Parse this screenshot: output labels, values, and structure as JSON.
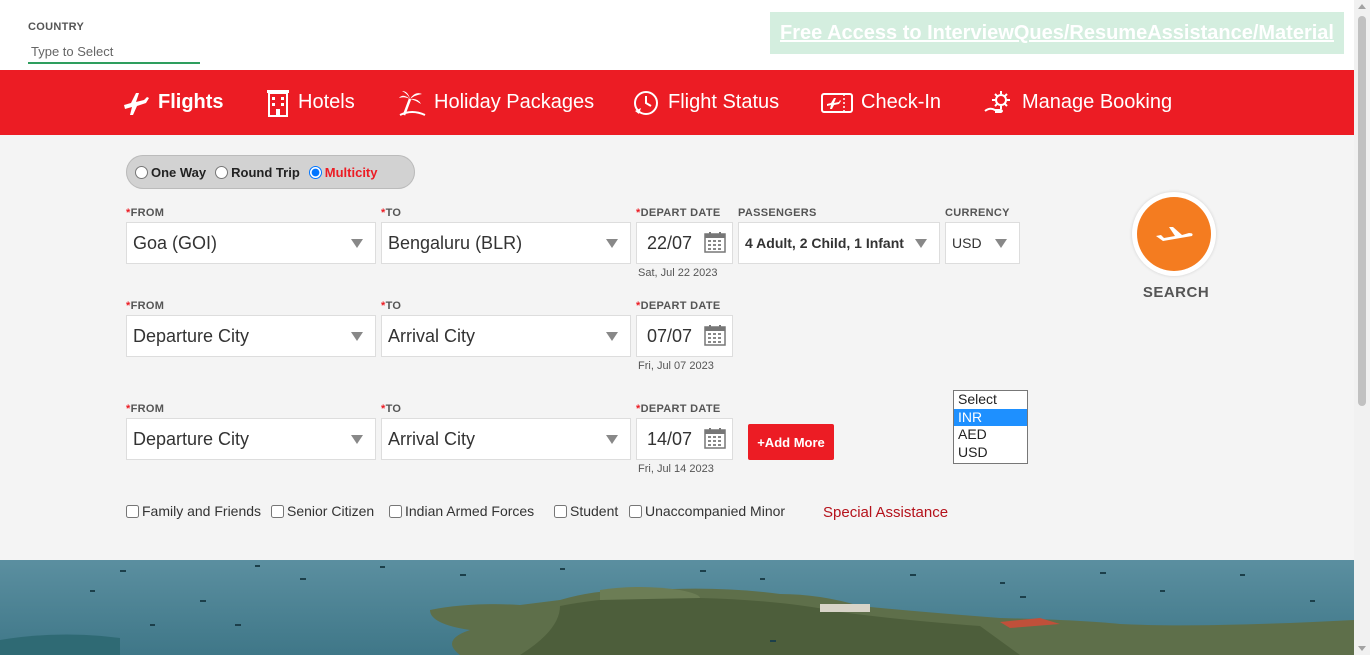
{
  "country": {
    "label": "COUNTRY",
    "placeholder": "Type to Select"
  },
  "promo": {
    "text": "Free Access to InterviewQues/ResumeAssistance/Material"
  },
  "nav": {
    "items": [
      {
        "label": "Flights",
        "icon": "plane-icon"
      },
      {
        "label": "Hotels",
        "icon": "hotel-icon"
      },
      {
        "label": "Holiday Packages",
        "icon": "palm-tree-icon"
      },
      {
        "label": "Flight Status",
        "icon": "flight-status-icon"
      },
      {
        "label": "Check-In",
        "icon": "boarding-pass-icon"
      },
      {
        "label": "Manage Booking",
        "icon": "gear-hand-icon"
      }
    ]
  },
  "trip_type": {
    "options": [
      "One Way",
      "Round Trip",
      "Multicity"
    ],
    "selected": "Multicity"
  },
  "labels": {
    "from": "FROM",
    "to": "TO",
    "depart_date": "DEPART DATE",
    "passengers": "PASSENGERS",
    "currency": "CURRENCY",
    "required": "*"
  },
  "legs": [
    {
      "from": "Goa (GOI)",
      "to": "Bengaluru (BLR)",
      "date": "22/07",
      "date_full": "Sat, Jul 22 2023"
    },
    {
      "from": "Departure City",
      "to": "Arrival City",
      "date": "07/07",
      "date_full": "Fri, Jul 07 2023"
    },
    {
      "from": "Departure City",
      "to": "Arrival City",
      "date": "14/07",
      "date_full": "Fri, Jul 14 2023"
    }
  ],
  "passengers": {
    "value": "4 Adult, 2 Child, 1 Infant"
  },
  "currency": {
    "value": "USD",
    "options": [
      "Select",
      "INR",
      "AED",
      "USD"
    ],
    "highlighted": "INR"
  },
  "add_more": {
    "label": "+Add More"
  },
  "search": {
    "label": "SEARCH"
  },
  "discounts": [
    "Family and Friends",
    "Senior Citizen",
    "Indian Armed Forces",
    "Student",
    "Unaccompanied Minor"
  ],
  "special_assistance": "Special Assistance",
  "colors": {
    "brand_red": "#ec1c24",
    "search_orange": "#f47c20",
    "promo_bg": "#d4eedf",
    "input_underline": "#2e9e5e"
  }
}
